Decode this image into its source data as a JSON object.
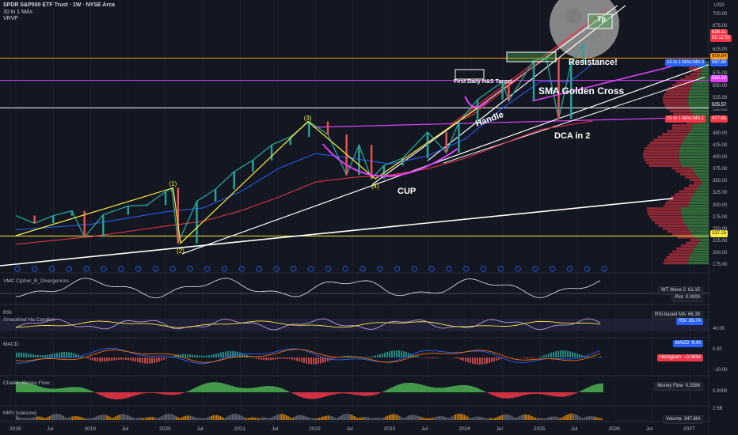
{
  "header": {
    "title": "SPDR S&P500 ETF Trust · 1W · NYSE Arca",
    "line2": "10 in 1 MAs",
    "line3": "VRVP",
    "currency": "USD"
  },
  "pane_labels": {
    "wavetrend": "VMC Cipher_B_Divergences",
    "rsi": "RSI",
    "heikin": "Smoothed Ha Candles",
    "macd": "MACD",
    "cmf": "Chaikin Money Flow",
    "hmv": "HMV [sdecow]"
  },
  "chart_data": {
    "type": "candlestick",
    "symbol": "SPY",
    "timeframe": "1W",
    "x_ticks": [
      "2018",
      "Jul",
      "2019",
      "Jul",
      "2020",
      "Jul",
      "2021",
      "Jul",
      "2022",
      "Jul",
      "2023",
      "Jul",
      "2024",
      "Jul",
      "2025",
      "Jul",
      "2026",
      "Jul",
      "2027"
    ],
    "y_ticks": [
      "700.00",
      "675.00",
      "650.00",
      "625.00",
      "600.00",
      "575.00",
      "550.00",
      "525.00",
      "500.00",
      "475.00",
      "450.00",
      "425.00",
      "400.00",
      "375.00",
      "350.00",
      "325.00",
      "300.00",
      "275.00",
      "250.00",
      "225.00",
      "200.00",
      "175.00"
    ],
    "ylim": [
      165,
      712
    ],
    "price_series": [
      {
        "date": "2018-01",
        "value": 280
      },
      {
        "date": "2018-04",
        "value": 264
      },
      {
        "date": "2018-07",
        "value": 280
      },
      {
        "date": "2018-10",
        "value": 290
      },
      {
        "date": "2018-12",
        "value": 235
      },
      {
        "date": "2019-03",
        "value": 282
      },
      {
        "date": "2019-07",
        "value": 300
      },
      {
        "date": "2019-10",
        "value": 302
      },
      {
        "date": "2020-01",
        "value": 330
      },
      {
        "date": "2020-02",
        "value": 338
      },
      {
        "date": "2020-03",
        "value": 222
      },
      {
        "date": "2020-06",
        "value": 310
      },
      {
        "date": "2020-09",
        "value": 335
      },
      {
        "date": "2020-12",
        "value": 372
      },
      {
        "date": "2021-03",
        "value": 396
      },
      {
        "date": "2021-06",
        "value": 428
      },
      {
        "date": "2021-09",
        "value": 445
      },
      {
        "date": "2021-12",
        "value": 477
      },
      {
        "date": "2022-03",
        "value": 450
      },
      {
        "date": "2022-06",
        "value": 365
      },
      {
        "date": "2022-08",
        "value": 428
      },
      {
        "date": "2022-10",
        "value": 357
      },
      {
        "date": "2022-12",
        "value": 385
      },
      {
        "date": "2023-03",
        "value": 400
      },
      {
        "date": "2023-07",
        "value": 455
      },
      {
        "date": "2023-10",
        "value": 412
      },
      {
        "date": "2023-12",
        "value": 476
      },
      {
        "date": "2024-03",
        "value": 523
      },
      {
        "date": "2024-07",
        "value": 560
      },
      {
        "date": "2024-08",
        "value": 520
      },
      {
        "date": "2024-12",
        "value": 605
      },
      {
        "date": "2025-02",
        "value": 610
      },
      {
        "date": "2025-04",
        "value": 482
      },
      {
        "date": "2025-06",
        "value": 600
      },
      {
        "date": "2025-08",
        "value": 639
      }
    ],
    "horizontal_levels": [
      {
        "label": "609.84",
        "value": 609.84,
        "color": "#ff9800"
      },
      {
        "label": "505.57",
        "value": 505.57,
        "color": "#ffffff"
      },
      {
        "label": "563.10",
        "value": 563.1,
        "color": "#e040fb"
      },
      {
        "label": "237.25",
        "value": 237.25,
        "color": "#ffeb3b"
      }
    ],
    "price_tags": [
      {
        "name": "",
        "value": "639.11",
        "color": "#f23645"
      },
      {
        "name": "",
        "value": "02:12:51",
        "color": "#f23645"
      },
      {
        "name": "",
        "value": "609.84",
        "color": "#ff9800"
      },
      {
        "name": "10 in 1 MAs:MA 3",
        "value": "597.85",
        "color": "#2962ff"
      },
      {
        "name": "",
        "value": "563.10",
        "color": "#e040fb"
      },
      {
        "name": "",
        "value": "505.57",
        "color": "#1e222d"
      },
      {
        "name": "10 in 1 MAs:MA 1",
        "value": "477.61",
        "color": "#f23645"
      },
      {
        "name": "",
        "value": "237.25",
        "color": "#ffeb3b"
      }
    ],
    "wave_labels": [
      "(1)",
      "(2)",
      "(3)",
      "(4)"
    ],
    "annotations": [
      "Resistance!",
      "First Daily H&S Target",
      "SMA Golden Cross",
      "Handle",
      "DCA in 2",
      "CUP",
      "Tp"
    ],
    "panes": {
      "wavetrend": {
        "tags": [
          {
            "name": "WT Wave 2",
            "value": "61.15"
          },
          {
            "name": "Plot",
            "value": "0.0000"
          }
        ]
      },
      "rsi": {
        "tags": [
          {
            "name": "RSI-based MA",
            "value": "66.39"
          },
          {
            "name": "RSI",
            "value": "65.74"
          }
        ],
        "y_ticks": [
          "40.00"
        ]
      },
      "macd": {
        "tags": [
          {
            "name": "MACD",
            "value": "9.40"
          },
          {
            "name": "Histogram",
            "value": "−0.0654"
          }
        ],
        "y_ticks": [
          "0.00",
          "−10.00"
        ]
      },
      "cmf": {
        "tags": [
          {
            "name": "Money Flow",
            "value": "0.3388"
          }
        ],
        "y_ticks": [
          "0.0000"
        ]
      },
      "hmv": {
        "tags": [
          {
            "name": "Volume",
            "value": "347.6M"
          }
        ],
        "y_ticks": [
          "2.5B"
        ]
      }
    }
  }
}
